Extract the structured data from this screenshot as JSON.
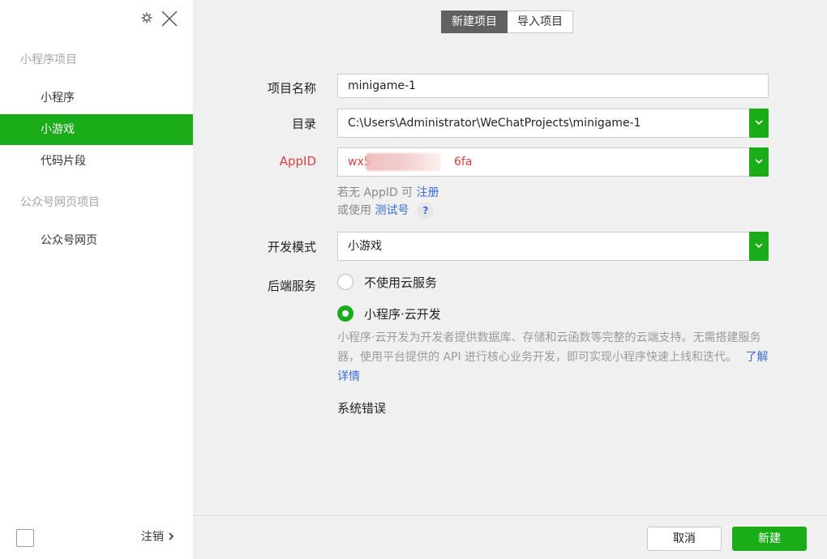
{
  "sidebar": {
    "group_miniprogram": "小程序项目",
    "items": [
      {
        "label": "小程序"
      },
      {
        "label": "小游戏"
      },
      {
        "label": "代码片段"
      }
    ],
    "group_official": "公众号网页项目",
    "official_items": [
      {
        "label": "公众号网页"
      }
    ],
    "logout": "注销"
  },
  "header": {
    "tabs": [
      {
        "label": "新建项目"
      },
      {
        "label": "导入项目"
      }
    ]
  },
  "form": {
    "project_name_label": "项目名称",
    "project_name_value": "minigame-1",
    "directory_label": "目录",
    "directory_value": "C:\\Users\\Administrator\\WeChatProjects\\minigame-1",
    "appid_label": "AppID",
    "appid_value_start": "wx5",
    "appid_value_end": "6fa",
    "appid_hint_prefix": "若无 AppID 可",
    "appid_hint_register": "注册",
    "appid_hint2_prefix": "或使用",
    "appid_hint2_test": "测试号",
    "help_label": "?",
    "dev_mode_label": "开发模式",
    "dev_mode_value": "小游戏",
    "backend_label": "后端服务",
    "backend_option_none": "不使用云服务",
    "backend_option_cloud": "小程序·云开发",
    "cloud_desc": "小程序·云开发为开发者提供数据库、存储和云函数等完整的云端支持。无需搭建服务器，使用平台提供的 API 进行核心业务开发，即可实现小程序快速上线和迭代。",
    "cloud_learn_more": "了解详情",
    "system_error": "系统错误"
  },
  "footer": {
    "cancel": "取消",
    "create": "新建"
  },
  "colors": {
    "accent": "#1aad19",
    "link": "#3a6bd8",
    "error": "#d94040"
  }
}
